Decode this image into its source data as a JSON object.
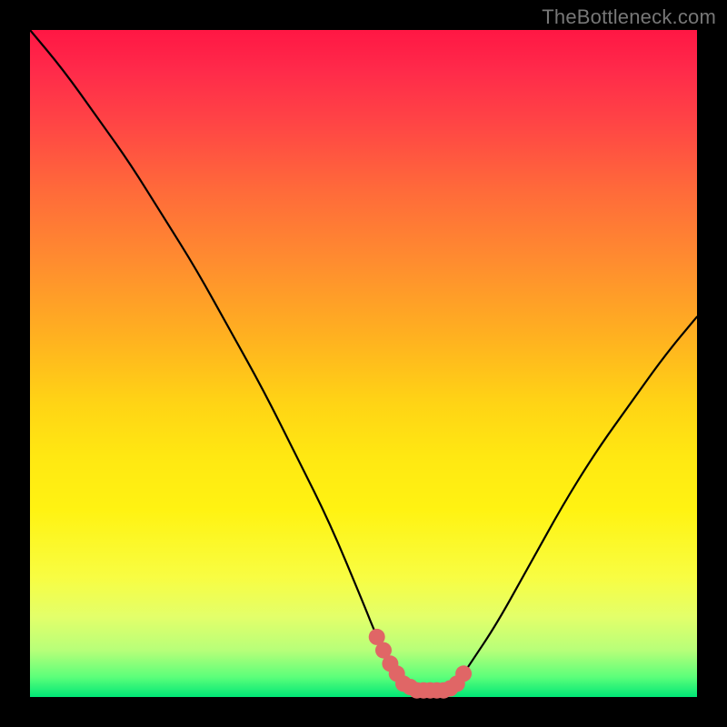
{
  "watermark": "TheBottleneck.com",
  "chart_data": {
    "type": "line",
    "title": "",
    "xlabel": "",
    "ylabel": "",
    "xlim": [
      0,
      100
    ],
    "ylim": [
      0,
      100
    ],
    "grid": false,
    "legend": false,
    "curve": {
      "name": "bottleneck-curve",
      "x": [
        0,
        5,
        10,
        15,
        20,
        25,
        30,
        35,
        40,
        45,
        50,
        52,
        54,
        56,
        58,
        60,
        62,
        64,
        66,
        70,
        75,
        80,
        85,
        90,
        95,
        100
      ],
      "y": [
        100,
        94,
        87,
        80,
        72,
        64,
        55,
        46,
        36,
        26,
        14,
        9,
        5,
        2,
        1,
        1,
        1,
        2,
        5,
        11,
        20,
        29,
        37,
        44,
        51,
        57
      ]
    },
    "markers": {
      "name": "highlight-band",
      "color": "#e06666",
      "x": [
        52,
        53,
        54,
        55,
        56,
        57,
        58,
        59,
        60,
        61,
        62,
        63,
        64,
        65
      ],
      "y": [
        9,
        7,
        5,
        3.5,
        2,
        1.5,
        1,
        1,
        1,
        1,
        1,
        1.3,
        2,
        3.5
      ]
    },
    "background_gradient": {
      "top": "#ff1744",
      "bottom": "#00e676"
    }
  }
}
